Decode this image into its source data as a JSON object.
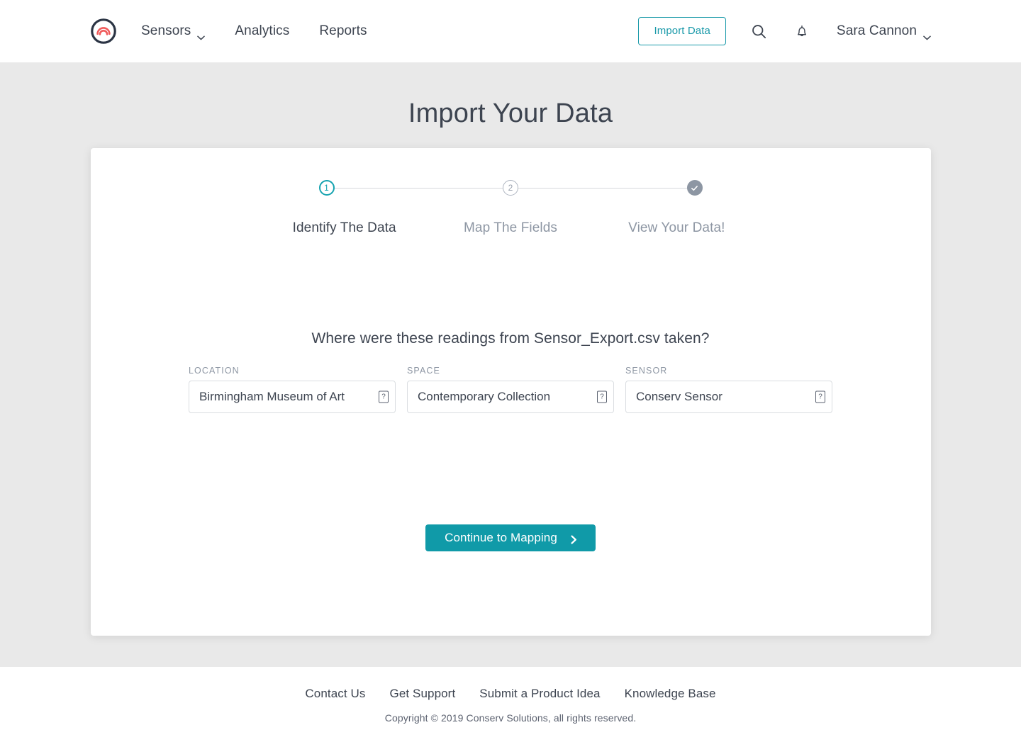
{
  "header": {
    "logo_name": "conserv-logo",
    "nav": [
      {
        "label": "Sensors",
        "has_dropdown": true
      },
      {
        "label": "Analytics",
        "has_dropdown": false
      },
      {
        "label": "Reports",
        "has_dropdown": false
      }
    ],
    "import_button": "Import Data",
    "search_icon": "search-icon",
    "notifications_icon": "bell-icon",
    "user_name": "Sara Cannon",
    "accent_color": "#1b9aaa"
  },
  "page": {
    "title": "Import Your Data",
    "background_color": "#e9e9e9"
  },
  "stepper": {
    "steps": [
      {
        "marker": "1",
        "label": "Identify The Data",
        "state": "active"
      },
      {
        "marker": "2",
        "label": "Map The Fields",
        "state": "upcoming"
      },
      {
        "marker": "✓",
        "label": "View Your Data!",
        "state": "done"
      }
    ],
    "active_color": "#16a3b0",
    "inactive_color": "#8d96a3"
  },
  "form": {
    "question": "Where were these readings from Sensor_Export.csv taken?",
    "fields": [
      {
        "label": "LOCATION",
        "value": "Birmingham Museum of Art",
        "placeholder": "Location",
        "help_glyph": "?",
        "help_name": "location-help-icon"
      },
      {
        "label": "SPACE",
        "value": "Contemporary Collection",
        "placeholder": "Space",
        "help_glyph": "?",
        "help_name": "space-help-icon"
      },
      {
        "label": "SENSOR",
        "value": "Conserv Sensor",
        "placeholder": "Sensor",
        "help_glyph": "?",
        "help_name": "sensor-help-icon"
      }
    ],
    "cta_label": "Continue to Mapping",
    "cta_icon": "chevron-right-icon",
    "cta_color": "#109aa8"
  },
  "footer": {
    "links": [
      "Contact Us",
      "Get Support",
      "Submit a Product Idea",
      "Knowledge Base"
    ],
    "copyright": "Copyright © 2019 Conserv Solutions, all rights reserved."
  }
}
